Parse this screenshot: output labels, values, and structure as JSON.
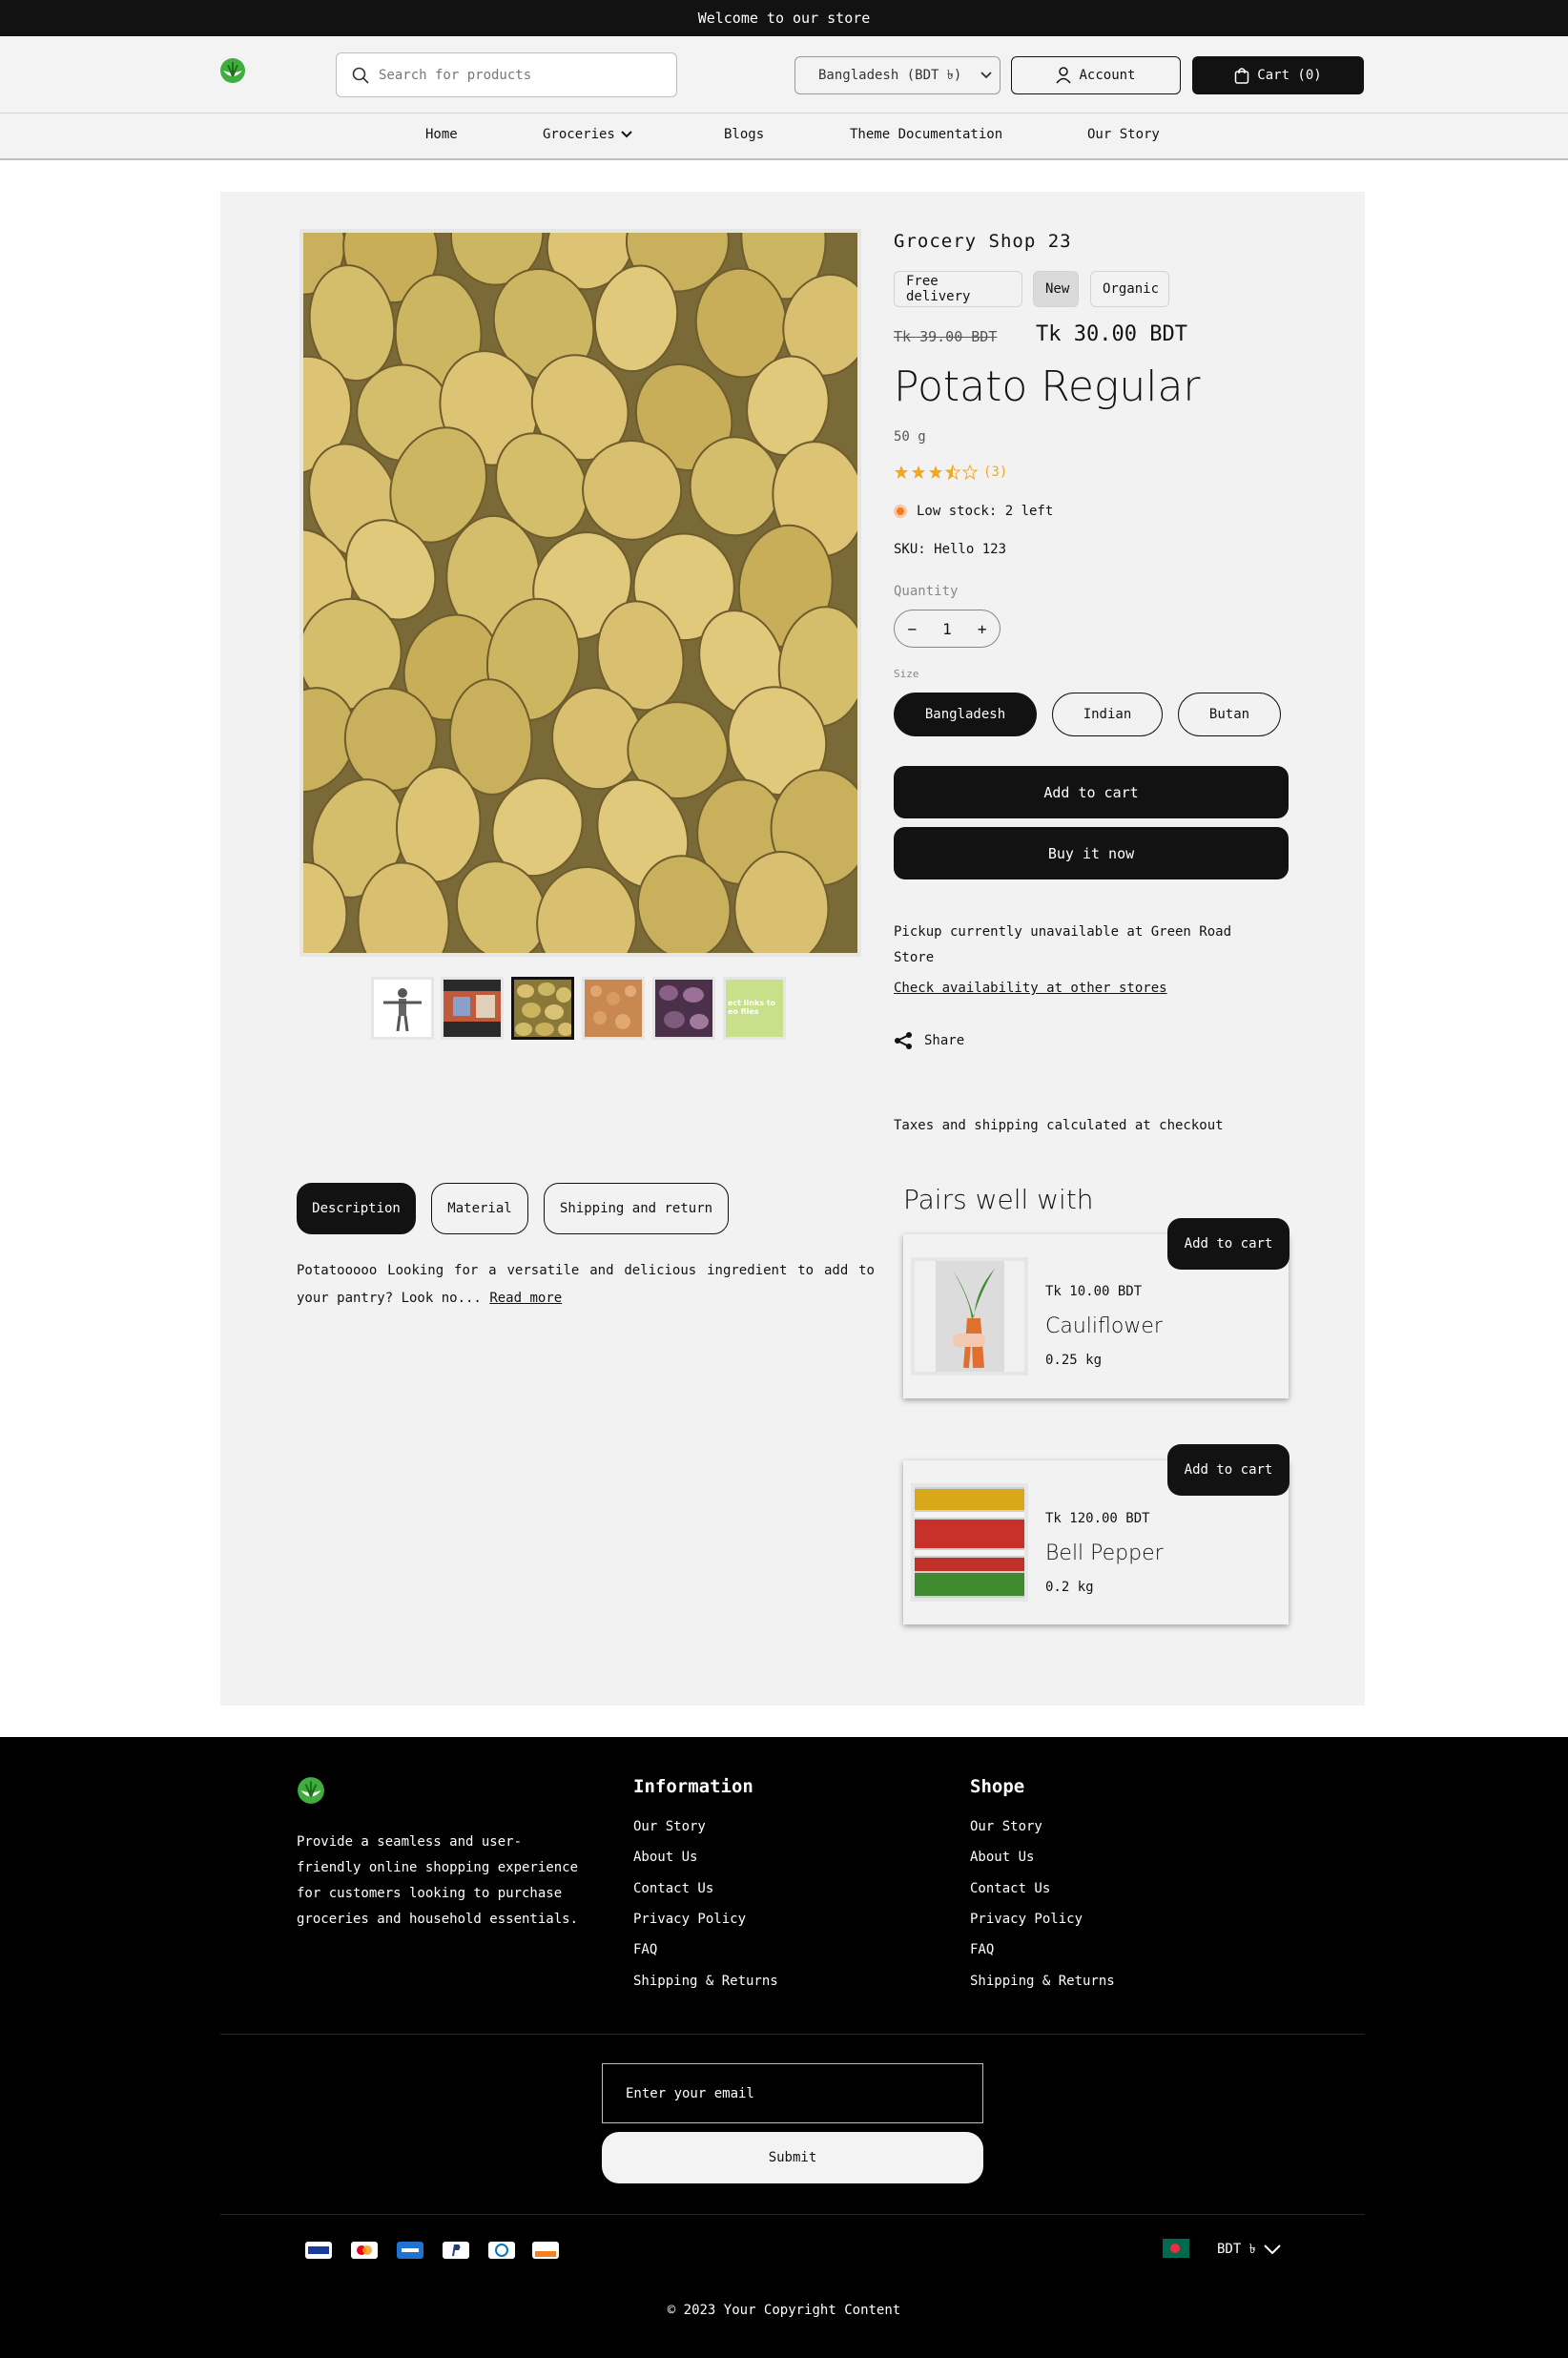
{
  "announcement": "Welcome to our store",
  "header": {
    "search_placeholder": "Search for products",
    "country": "Bangladesh (BDT ৳)",
    "account": "Account",
    "cart": "Cart (0)"
  },
  "nav": [
    "Home",
    "Groceries",
    "Blogs",
    "Theme Documentation",
    "Our Story"
  ],
  "product": {
    "vendor": "Grocery Shop 23",
    "badges": [
      "Free delivery",
      "New",
      "Organic"
    ],
    "compare_price": "Tk 39.00 BDT",
    "price": "Tk 30.00 BDT",
    "title": "Potato Regular",
    "weight": "50 g",
    "rating": 3.5,
    "rating_count": "(3)",
    "stock": "Low stock: 2 left",
    "sku": "SKU: Hello 123",
    "quantity_label": "Quantity",
    "quantity": "1",
    "size_label": "Size",
    "sizes": [
      "Bangladesh",
      "Indian",
      "Butan"
    ],
    "add_to_cart": "Add to cart",
    "buy_now": "Buy it now",
    "pickup": "Pickup currently unavailable at Green Road Store",
    "check": "Check availability at other stores",
    "share": "Share",
    "taxes": "Taxes and shipping calculated at checkout",
    "thumb_text": "ect links to eo files"
  },
  "tabs": [
    "Description",
    "Material",
    "Shipping and return"
  ],
  "description": "Potatooooo Looking for a versatile and delicious ingredient to add to your pantry? Look no...",
  "read_more": "Read more",
  "pairs": {
    "title": "Pairs well with",
    "items": [
      {
        "price": "Tk 10.00 BDT",
        "name": "Cauliflower",
        "weight": "0.25 kg",
        "button": "Add to cart"
      },
      {
        "price": "Tk 120.00 BDT",
        "name": "Bell Pepper",
        "weight": "0.2 kg",
        "button": "Add to cart"
      }
    ]
  },
  "footer": {
    "about": "Provide a seamless and user-friendly online shopping experience for customers looking to purchase groceries and household essentials.",
    "col1_title": "Information",
    "col2_title": "Shope",
    "links": [
      "Our Story",
      "About Us",
      "Contact Us",
      "Privacy Policy",
      "FAQ",
      "Shipping & Returns"
    ],
    "email_placeholder": "Enter your email",
    "submit": "Submit",
    "currency": "BDT ৳",
    "copyright": "© 2023 Your Copyright Content",
    "payments": [
      "visa",
      "mastercard",
      "amex",
      "paypal",
      "diners",
      "discover"
    ]
  },
  "colors": {
    "accent": "#121212",
    "star": "#f5a623",
    "stock_dot": "#f07b22",
    "logo": "#3fae3f"
  }
}
